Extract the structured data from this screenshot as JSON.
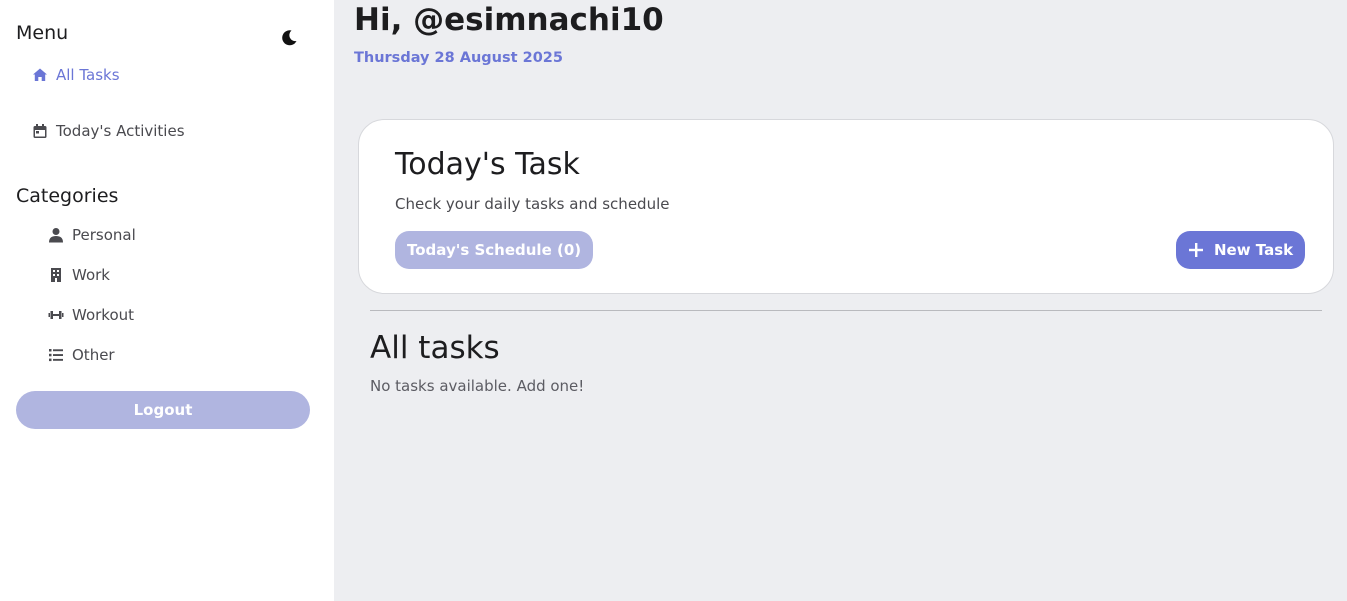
{
  "sidebar": {
    "menu_title": "Menu",
    "nav": [
      {
        "label": "All Tasks",
        "icon": "home-icon",
        "active": true
      },
      {
        "label": "Today's Activities",
        "icon": "calendar-icon",
        "active": false
      }
    ],
    "categories_title": "Categories",
    "categories": [
      {
        "label": "Personal",
        "icon": "user-icon"
      },
      {
        "label": "Work",
        "icon": "building-icon"
      },
      {
        "label": "Workout",
        "icon": "dumbbell-icon"
      },
      {
        "label": "Other",
        "icon": "list-icon"
      }
    ],
    "logout_label": "Logout",
    "theme_icon": "moon-icon"
  },
  "main": {
    "greeting": "Hi, @esimnachi10",
    "date": "Thursday 28 August 2025",
    "card": {
      "title": "Today's Task",
      "subtitle": "Check your daily tasks and schedule",
      "schedule_label": "Today's Schedule (0)",
      "new_task_label": "New Task"
    },
    "all_tasks_title": "All tasks",
    "empty_message": "No tasks available. Add one!"
  },
  "colors": {
    "accent": "#6b76d6",
    "accent_muted": "#b0b5e0",
    "background": "#edeef1",
    "sidebar_bg": "#ffffff"
  }
}
